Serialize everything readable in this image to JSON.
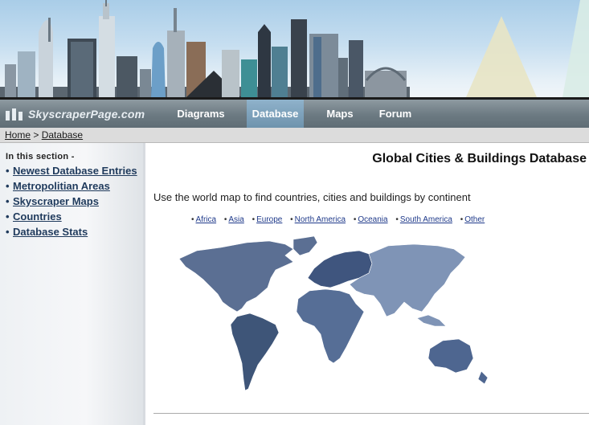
{
  "site": {
    "logo_text": "SkyscraperPage.com"
  },
  "nav": {
    "items": [
      {
        "label": "Diagrams",
        "active": false
      },
      {
        "label": "Database",
        "active": true
      },
      {
        "label": "Maps",
        "active": false
      },
      {
        "label": "Forum",
        "active": false
      }
    ]
  },
  "breadcrumb": {
    "home": "Home",
    "separator": ">",
    "current": "Database"
  },
  "sidebar": {
    "heading": "In this section -",
    "links": [
      "Newest Database Entries",
      "Metropolitian Areas",
      "Skyscraper Maps",
      "Countries",
      "Database Stats"
    ]
  },
  "main": {
    "title": "Global Cities & Buildings Database",
    "intro": "Use the world map to find countries, cities and buildings by continent",
    "continents": [
      "Africa",
      "Asia",
      "Europe",
      "North America",
      "Oceania",
      "South America",
      "Other"
    ]
  },
  "colors": {
    "nav_bg": "#6c7a82",
    "nav_active": "#7fa3bd",
    "link": "#1f3a5c",
    "map_north_america": "#5b6f93",
    "map_south_america": "#3e5578",
    "map_europe": "#3f557e",
    "map_africa": "#566e96",
    "map_asia": "#7f94b6",
    "map_oceania": "#4e6690"
  }
}
